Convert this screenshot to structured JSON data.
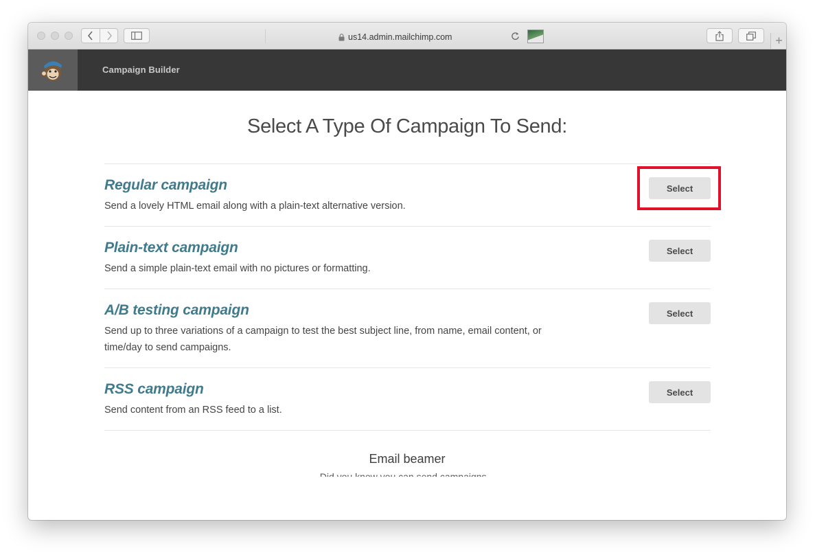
{
  "browser": {
    "url": "us14.admin.mailchimp.com",
    "new_tab_label": "+"
  },
  "app": {
    "header_title": "Campaign Builder"
  },
  "page": {
    "title": "Select A Type Of Campaign To Send:",
    "campaigns": [
      {
        "name": "Regular campaign",
        "description": "Send a lovely HTML email along with a plain-text alternative version.",
        "button": "Select"
      },
      {
        "name": "Plain-text campaign",
        "description": "Send a simple plain-text email with no pictures or formatting.",
        "button": "Select"
      },
      {
        "name": "A/B testing campaign",
        "description": "Send up to three variations of a campaign to test the best subject line, from name, email content, or time/day to send campaigns.",
        "button": "Select"
      },
      {
        "name": "RSS campaign",
        "description": "Send content from an RSS feed to a list.",
        "button": "Select"
      }
    ],
    "section_heading": "Email beamer",
    "section_desc": "Did you know you can send campaigns..."
  },
  "colors": {
    "header_bg": "#373737",
    "campaign_name": "#3f7b8c",
    "highlight": "#e0112b",
    "button_bg": "#e3e3e3"
  }
}
